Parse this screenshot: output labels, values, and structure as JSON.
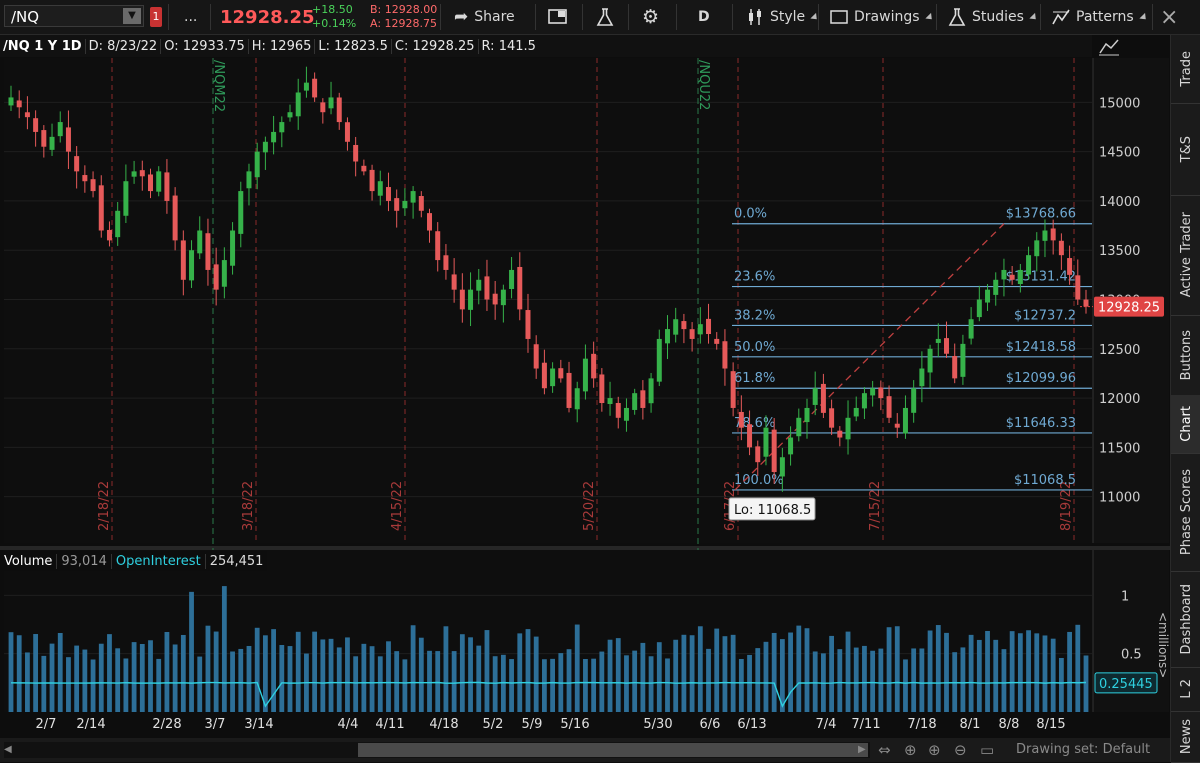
{
  "toolbar": {
    "symbol": "/NQ",
    "more": "...",
    "last_price": "12928.25",
    "change_abs": "+18.50",
    "change_pct": "+0.14%",
    "bid": "B: 12928.00",
    "ask": "A: 12928.75",
    "share_label": "Share",
    "period_label": "D",
    "style_label": "Style",
    "drawings_label": "Drawings",
    "studies_label": "Studies",
    "patterns_label": "Patterns"
  },
  "info": {
    "title": "/NQ 1 Y 1D",
    "date": "D: 8/23/22",
    "open": "O: 12933.75",
    "high": "H: 12965",
    "low": "L: 12823.5",
    "close": "C: 12928.25",
    "range": "R: 141.5"
  },
  "side_tabs": [
    "Trade",
    "T&S",
    "Active Trader",
    "Buttons",
    "Chart",
    "Phase Scores",
    "Dashboard",
    "L 2",
    "News"
  ],
  "volume_header": {
    "label": "Volume",
    "value": "93,014",
    "oi_label": "OpenInterest",
    "oi_value": "254,451"
  },
  "bottom": {
    "drawing_set": "Drawing set: Default"
  },
  "colors": {
    "up": "#36b24a",
    "down": "#e65a5a",
    "fib": "#6fa9d2",
    "volume": "#2d6f98",
    "oi": "#2fd0e0",
    "price_tag": "#e04545"
  },
  "chart_data": [
    {
      "type": "candlestick",
      "price_ticks": [
        11000,
        11500,
        12000,
        12500,
        13000,
        13500,
        14000,
        14500,
        15000
      ],
      "ylim": [
        10530,
        15450
      ],
      "last_price_tag": "12928.25",
      "low_label": "Lo: 11068.5",
      "expiry_markers": [
        "/NQM22",
        "/NQU22"
      ],
      "month_markers": [
        "2/18/22",
        "3/18/22",
        "4/15/22",
        "5/20/22",
        "6/17/22",
        "7/15/22",
        "8/19/22"
      ],
      "fib_levels": [
        {
          "ratio": "0.0%",
          "price": 13768.66,
          "price_label": "$13768.66"
        },
        {
          "ratio": "23.6%",
          "price": 13131.42,
          "price_label": "$13131.42"
        },
        {
          "ratio": "38.2%",
          "price": 12737.2,
          "price_label": "$12737.2"
        },
        {
          "ratio": "50.0%",
          "price": 12418.58,
          "price_label": "$12418.58"
        },
        {
          "ratio": "61.8%",
          "price": 12099.96,
          "price_label": "$12099.96"
        },
        {
          "ratio": "78.6%",
          "price": 11646.33,
          "price_label": "$11646.33"
        },
        {
          "ratio": "100.0%",
          "price": 11068.5,
          "price_label": "$11068.5"
        }
      ],
      "x_tick_labels": [
        "2/7",
        "2/14",
        "2/28",
        "3/7",
        "3/14",
        "4/4",
        "4/11",
        "4/18",
        "5/2",
        "5/9",
        "5/16",
        "5/30",
        "6/6",
        "6/13",
        "7/4",
        "7/11",
        "7/18",
        "8/1",
        "8/8",
        "8/15"
      ],
      "close_path": [
        15050,
        14950,
        14850,
        14700,
        14550,
        14650,
        14800,
        14500,
        14300,
        14200,
        14100,
        13700,
        13600,
        13900,
        14200,
        14300,
        14250,
        14100,
        14300,
        14000,
        13600,
        13200,
        13500,
        13700,
        13300,
        13100,
        13400,
        13700,
        14100,
        14300,
        14500,
        14600,
        14700,
        14800,
        14900,
        15100,
        15200,
        15050,
        14900,
        15050,
        14800,
        14600,
        14400,
        14300,
        14100,
        14200,
        14000,
        13900,
        14000,
        14100,
        13900,
        13700,
        13400,
        13300,
        13100,
        12900,
        13100,
        13200,
        13000,
        12950,
        13100,
        13300,
        12900,
        12600,
        12300,
        12100,
        12300,
        12200,
        11900,
        12100,
        12400,
        12200,
        11950,
        12000,
        11800,
        11900,
        12050,
        11900,
        12200,
        12600,
        12700,
        12800,
        12700,
        12600,
        12750,
        12650,
        12550,
        12300,
        11900,
        11700,
        11500,
        11350,
        11700,
        11250,
        11400,
        11600,
        11800,
        11900,
        12100,
        11850,
        11700,
        11600,
        11800,
        11900,
        12050,
        12100,
        12000,
        11800,
        11700,
        11900,
        12100,
        12300,
        12500,
        12600,
        12450,
        12200,
        12550,
        12800,
        13000,
        13100,
        13200,
        13300,
        13200,
        13300,
        13450,
        13600,
        13700,
        13600,
        13450,
        13250,
        13000,
        12928
      ],
      "volume_ticks": [
        0.5,
        1
      ],
      "volume_unit": "<millions>",
      "volume_last": "0.25445",
      "volume_ylim": [
        0,
        1.2
      ],
      "oi_level": 0.25
    }
  ]
}
